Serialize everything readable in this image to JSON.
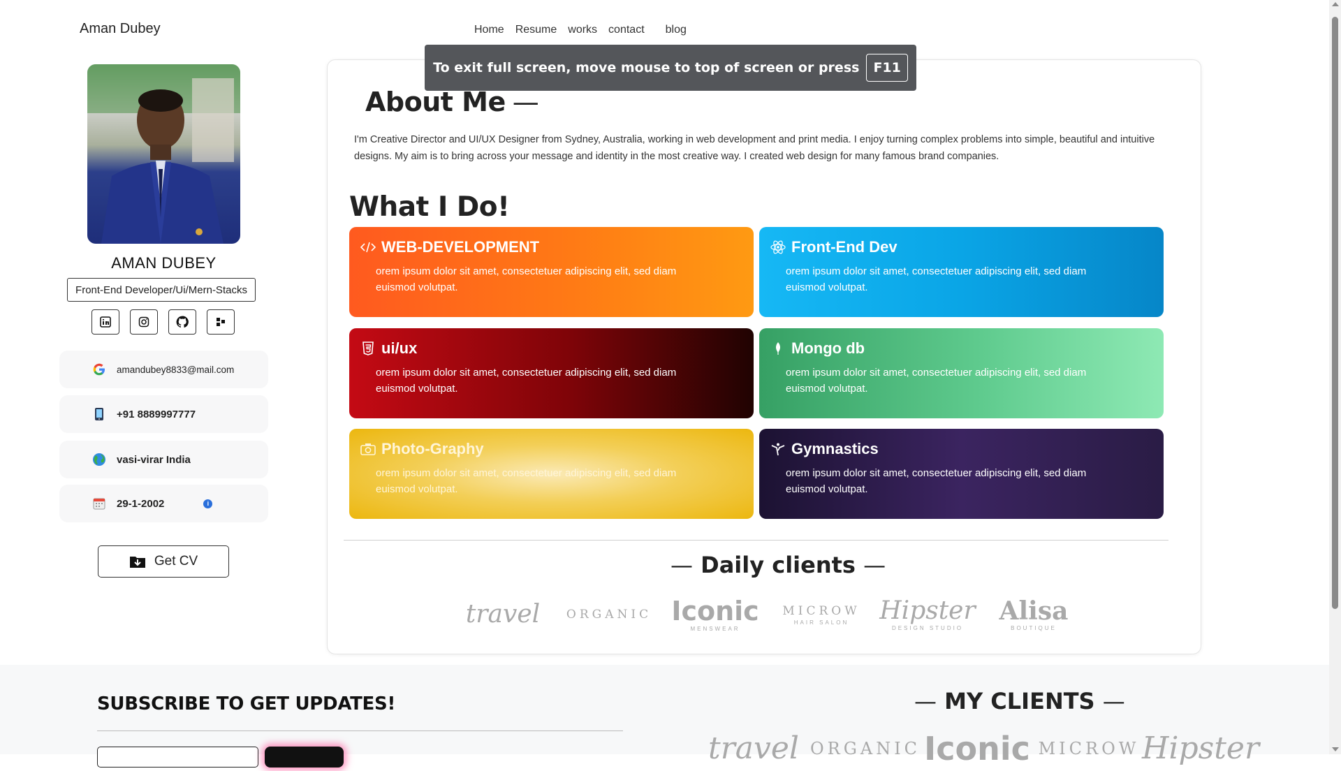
{
  "header": {
    "brand": "Aman Dubey",
    "nav": [
      "Home",
      "Resume",
      "works",
      "contact",
      "blog"
    ]
  },
  "fullscreen_toast": {
    "message": "To exit full screen, move mouse to top of screen or press",
    "key": "F11"
  },
  "profile": {
    "name": "AMAN DUBEY",
    "role": "Front-End Developer/Ui/Mern-Stacks",
    "socials": [
      "linkedin-icon",
      "instagram-icon",
      "github-icon",
      "codepen-icon"
    ],
    "email": "amandubey8833@mail.com",
    "phone": "+91 8889997777",
    "location": "vasi-virar India",
    "dob": "29-1-2002",
    "cv_button": "Get CV"
  },
  "about": {
    "title": "About Me",
    "dash": "—",
    "text": "I'm Creative Director and UI/UX Designer from Sydney, Australia, working in web development and print media. I enjoy turning complex problems into simple, beautiful and intuitive designs. My aim is to bring across your message and identity in the most creative way. I created web design for many famous brand companies."
  },
  "what_i_do": {
    "title": "What I Do!",
    "services": [
      {
        "title": "WEB-DEVELOPMENT",
        "desc": "orem ipsum dolor sit amet, consectetuer adipiscing elit, sed diam euismod volutpat.",
        "icon": "code-icon",
        "color": "#ff7a15"
      },
      {
        "title": "Front-End Dev",
        "desc": "orem ipsum dolor sit amet, consectetuer adipiscing elit, sed diam euismod volutpat.",
        "icon": "react-icon",
        "color": "#0aa5e6"
      },
      {
        "title": "ui/ux",
        "desc": "orem ipsum dolor sit amet, consectetuer adipiscing elit, sed diam euismod volutpat.",
        "icon": "html5-icon",
        "color": "#8b0509"
      },
      {
        "title": "Mongo db",
        "desc": "orem ipsum dolor sit amet, consectetuer adipiscing elit, sed diam euismod volutpat.",
        "icon": "leaf-icon",
        "color": "#5fcb8e"
      },
      {
        "title": "Photo-Graphy",
        "desc": "orem ipsum dolor sit amet, consectetuer adipiscing elit, sed diam euismod volutpat.",
        "icon": "camera-icon",
        "color": "#f3cf58"
      },
      {
        "title": "Gymnastics",
        "desc": "orem ipsum dolor sit amet, consectetuer adipiscing elit, sed diam euismod volutpat.",
        "icon": "gymnast-icon",
        "color": "#3b2460"
      }
    ]
  },
  "daily_clients": {
    "title": "Daily clients",
    "dash": "—",
    "logos": [
      {
        "name": "travel",
        "sub": ""
      },
      {
        "name": "ORGANIC",
        "sub": ""
      },
      {
        "name": "Iconic",
        "sub": "MENSWEAR"
      },
      {
        "name": "MICROW",
        "sub": "HAIR SALON"
      },
      {
        "name": "Hipster",
        "sub": "DESIGN STUDIO"
      },
      {
        "name": "Alisa",
        "sub": "BOUTIQUE"
      }
    ]
  },
  "footer": {
    "subscribe_title": "SUBSCRIBE TO GET UPDATES!",
    "clients_title": "MY CLIENTS",
    "dash": "—",
    "client_logos": [
      "travel",
      "ORGANIC",
      "Iconic",
      "MICROW",
      "Hipster"
    ]
  }
}
